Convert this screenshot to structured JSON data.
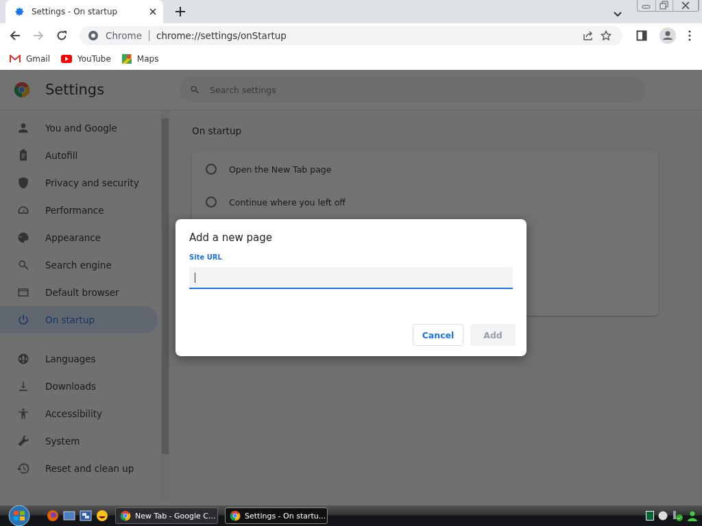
{
  "browser": {
    "tabs": [
      {
        "title": "Settings - On startup",
        "selected": true
      }
    ],
    "toolbar": {
      "site_label": "Chrome",
      "url": "chrome://settings/onStartup"
    },
    "bookmarks": [
      {
        "label": "Gmail"
      },
      {
        "label": "YouTube"
      },
      {
        "label": "Maps"
      }
    ]
  },
  "settings": {
    "title": "Settings",
    "search": {
      "placeholder": "Search settings"
    },
    "sidebar": {
      "sections": [
        {
          "items": [
            {
              "label": "You and Google",
              "selected": false
            },
            {
              "label": "Autofill",
              "selected": false
            },
            {
              "label": "Privacy and security",
              "selected": false
            },
            {
              "label": "Performance",
              "selected": false
            },
            {
              "label": "Appearance",
              "selected": false
            },
            {
              "label": "Search engine",
              "selected": false
            },
            {
              "label": "Default browser",
              "selected": false
            },
            {
              "label": "On startup",
              "selected": true
            }
          ]
        },
        {
          "items": [
            {
              "label": "Languages",
              "selected": false
            },
            {
              "label": "Downloads",
              "selected": false
            },
            {
              "label": "Accessibility",
              "selected": false
            },
            {
              "label": "System",
              "selected": false
            },
            {
              "label": "Reset and clean up",
              "selected": false
            }
          ]
        }
      ]
    },
    "section_title": "On startup",
    "options": [
      {
        "label": "Open the New Tab page",
        "selected": false
      },
      {
        "label": "Continue where you left off",
        "selected": false
      }
    ]
  },
  "dialog": {
    "title": "Add a new page",
    "field_label": "Site URL",
    "buttons": [
      {
        "label": "Cancel",
        "disabled": false
      },
      {
        "label": "Add",
        "disabled": true
      }
    ]
  },
  "taskbar": {
    "tasks": [
      {
        "title": "New Tab - Google C...",
        "selected": false
      },
      {
        "title": "Settings - On startu...",
        "selected": true
      }
    ]
  }
}
